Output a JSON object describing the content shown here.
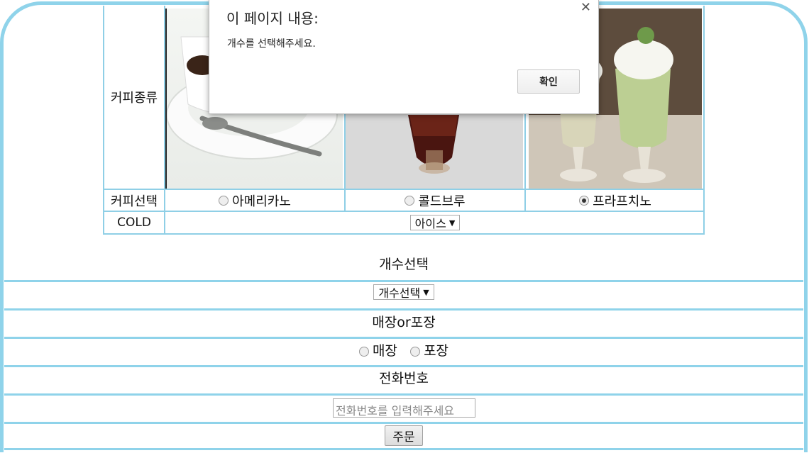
{
  "coffee_table": {
    "type_label": "커피종류",
    "select_label": "커피선택",
    "options": [
      "아메리카노",
      "콜드브루",
      "프라프치노"
    ],
    "selected_option": "프라프치노",
    "cold_label": "COLD",
    "temperature_value": "아이스"
  },
  "form": {
    "quantity_heading": "개수선택",
    "quantity_value": "개수선택",
    "place_heading": "매장or포장",
    "place_options": [
      "매장",
      "포장"
    ],
    "phone_heading": "전화번호",
    "phone_placeholder": "전화번호를 입력해주세요",
    "submit_label": "주문"
  },
  "dialog": {
    "title": "이 페이지 내용:",
    "message": "개수를 선택해주세요.",
    "ok_label": "확인",
    "close_icon": "close-icon"
  },
  "colors": {
    "border_accent": "#8fd3ea"
  }
}
